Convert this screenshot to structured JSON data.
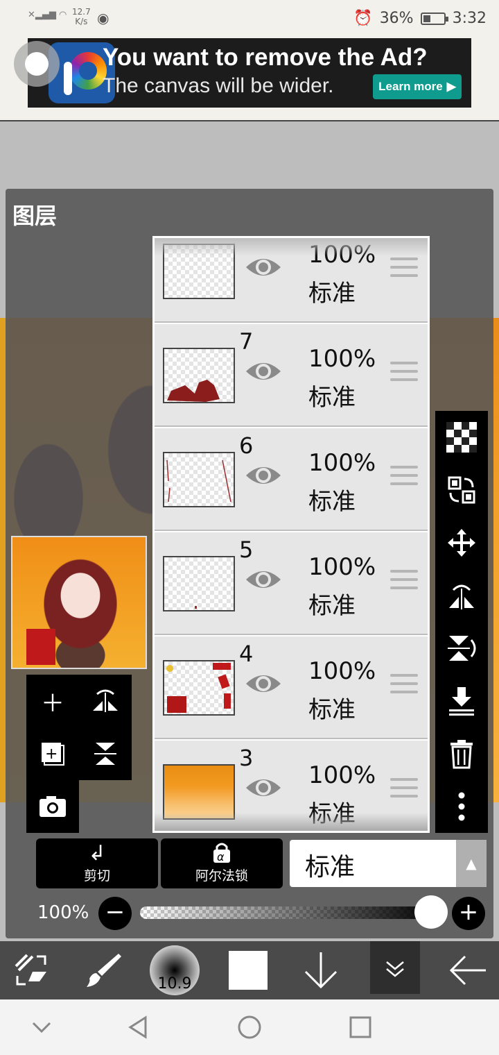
{
  "status_bar": {
    "speed_value": "12.7",
    "speed_unit": "K/s",
    "battery": "36%",
    "battery_level": 0.36,
    "time": "3:32"
  },
  "ad": {
    "title": "You want to remove the Ad?",
    "subtitle": "The canvas will be wider.",
    "button": "Learn more"
  },
  "panel": {
    "title": "图层"
  },
  "layers": [
    {
      "number": "",
      "opacity": "100%",
      "mode": "标准"
    },
    {
      "number": "7",
      "opacity": "100%",
      "mode": "标准"
    },
    {
      "number": "6",
      "opacity": "100%",
      "mode": "标准"
    },
    {
      "number": "5",
      "opacity": "100%",
      "mode": "标准"
    },
    {
      "number": "4",
      "opacity": "100%",
      "mode": "标准"
    },
    {
      "number": "3",
      "opacity": "100%",
      "mode": "标准"
    }
  ],
  "actions": {
    "clip_label": "剪切",
    "alpha_lock_label": "阿尔法锁"
  },
  "blend_mode": {
    "value": "标准"
  },
  "opacity": {
    "label": "100%",
    "value": 100
  },
  "toolbar": {
    "brush_size": "10.9",
    "current_color": "#ffffff"
  },
  "colors": {
    "panel_bg": "#555555",
    "ad_button": "#0f9c8e",
    "toolbar_bg": "#4a4a4a",
    "artwork_orange": "#f2a32a"
  },
  "icons": {
    "layer_visibility": "eye-icon",
    "layer_handle": "drag-handle-icon",
    "side": [
      "transparency-icon",
      "transfer-icon",
      "move-icon",
      "flip-horizontal-icon",
      "flip-vertical-icon",
      "merge-down-icon",
      "trash-icon",
      "more-icon"
    ]
  }
}
